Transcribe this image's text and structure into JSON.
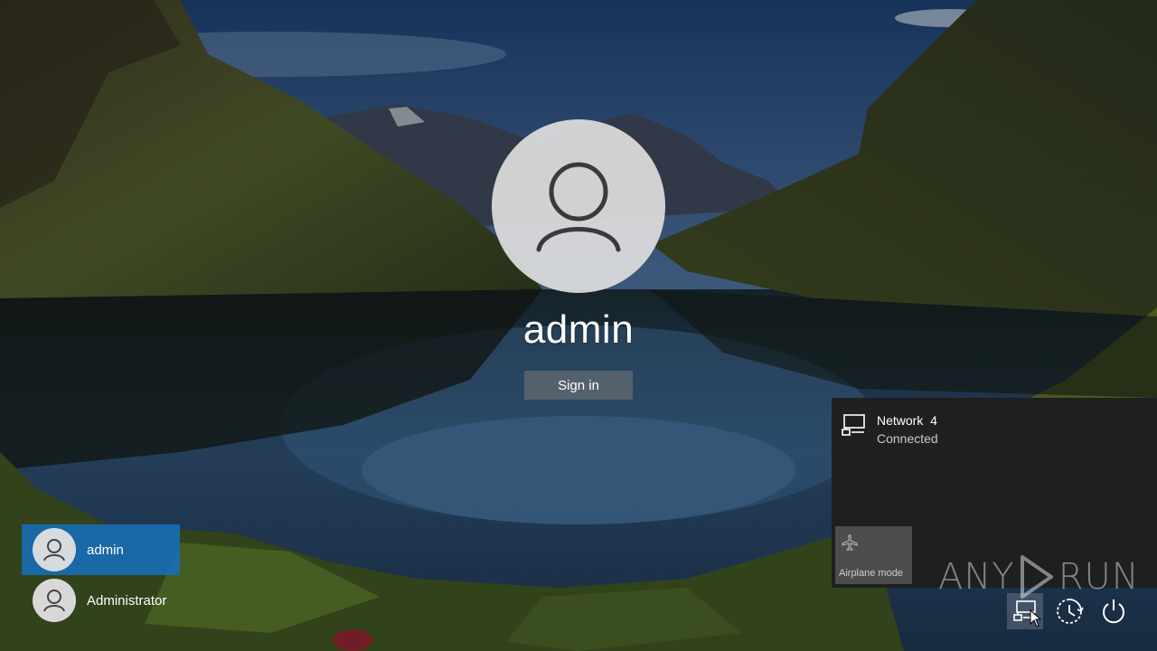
{
  "current_user": {
    "name": "admin",
    "signin_label": "Sign in"
  },
  "user_list": [
    {
      "name": "admin",
      "selected": true
    },
    {
      "name": "Administrator",
      "selected": false
    }
  ],
  "network_flyout": {
    "network_name": "Network  4",
    "network_status": "Connected",
    "airplane_label": "Airplane mode"
  },
  "watermark": {
    "left": "ANY",
    "right": "RUN"
  },
  "system_icons": [
    "network-icon",
    "accessibility-icon",
    "power-icon"
  ],
  "colors": {
    "selected_user_bg": "#166ebe",
    "flyout_bg": "#1f1f1f",
    "airplane_tile_bg": "#4d4d4d"
  }
}
